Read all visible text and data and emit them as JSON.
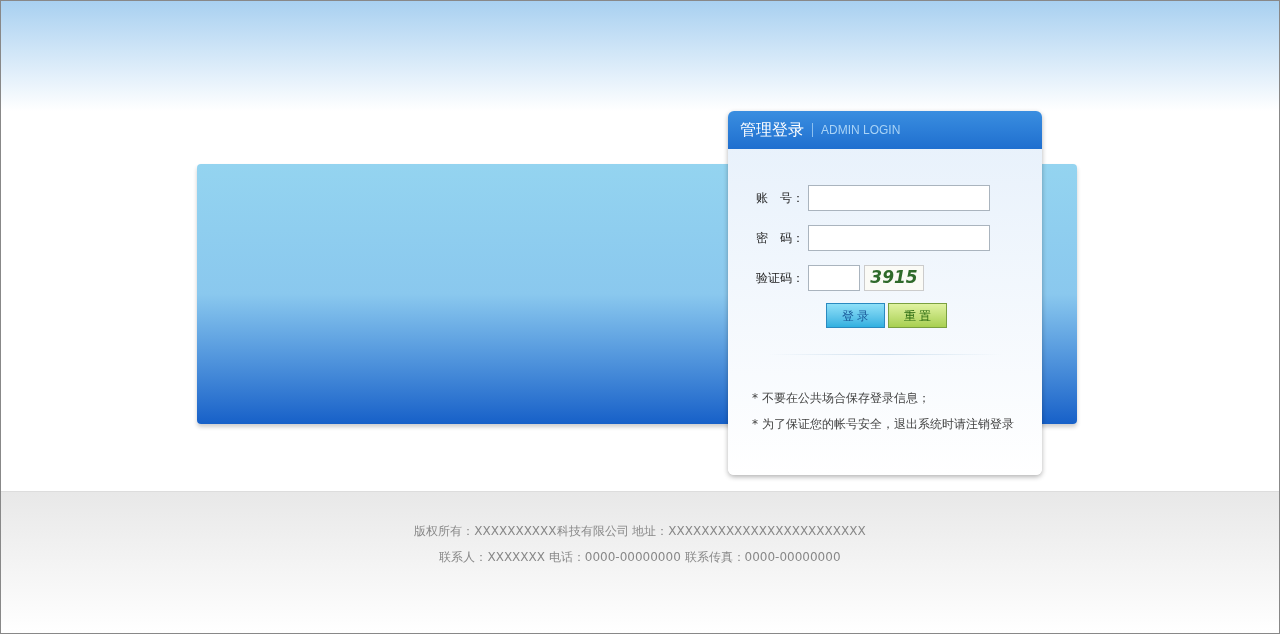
{
  "login": {
    "title": "管理登录",
    "subtitle": "ADMIN LOGIN"
  },
  "fields": [
    {
      "kind": "text",
      "label": "账　号："
    },
    {
      "kind": "password",
      "label": "密　码："
    },
    {
      "kind": "captcha",
      "label": "验证码：",
      "captcha": "3915"
    }
  ],
  "buttons": [
    {
      "kind": "primary",
      "label": "登 录"
    },
    {
      "kind": "secondary",
      "label": "重 置"
    }
  ],
  "tips": [
    "* 不要在公共场合保存登录信息；",
    "* 为了保证您的帐号安全，退出系统时请注销登录"
  ],
  "footer": [
    "版权所有：XXXXXXXXXX科技有限公司 地址：XXXXXXXXXXXXXXXXXXXXXXXX",
    "联系人：XXXXXXX 电话：0000-00000000 联系传真：0000-00000000"
  ]
}
